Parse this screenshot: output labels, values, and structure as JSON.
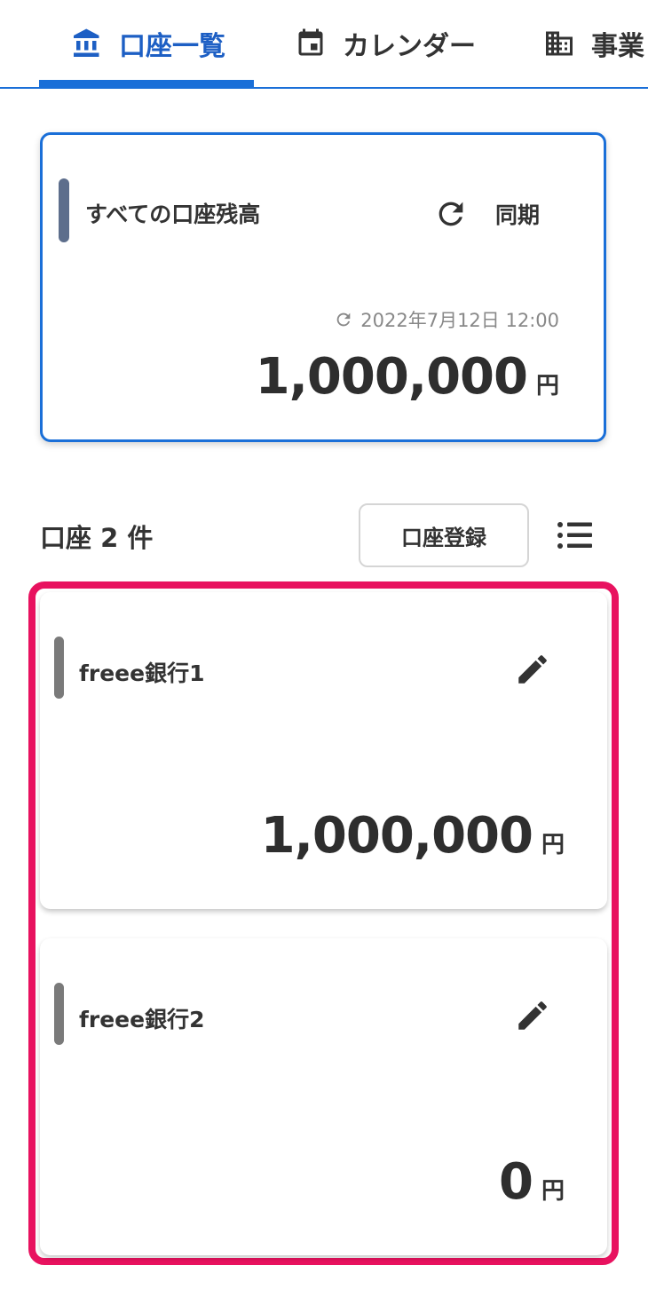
{
  "tabs": [
    {
      "label": "口座一覧",
      "icon": "bank-icon",
      "active": true
    },
    {
      "label": "カレンダー",
      "icon": "calendar-icon",
      "active": false
    },
    {
      "label": "事業",
      "icon": "building-icon",
      "active": false
    }
  ],
  "summary": {
    "title": "すべての口座残高",
    "sync_label": "同期",
    "sync_icon": "refresh-icon",
    "updated_at": "2022年7月12日 12:00",
    "amount": "1,000,000",
    "unit": "円"
  },
  "accounts_header": {
    "count_label": "口座 2 件",
    "register_label": "口座登録",
    "list_icon": "list-icon"
  },
  "accounts": [
    {
      "name": "freee銀行1",
      "amount": "1,000,000",
      "unit": "円"
    },
    {
      "name": "freee銀行2",
      "amount": "0",
      "unit": "円"
    }
  ],
  "colors": {
    "accent": "#1a6fd8",
    "highlight": "#e8125f",
    "summary_bar": "#5d6e8c",
    "account_bar": "#7a7a7a"
  }
}
